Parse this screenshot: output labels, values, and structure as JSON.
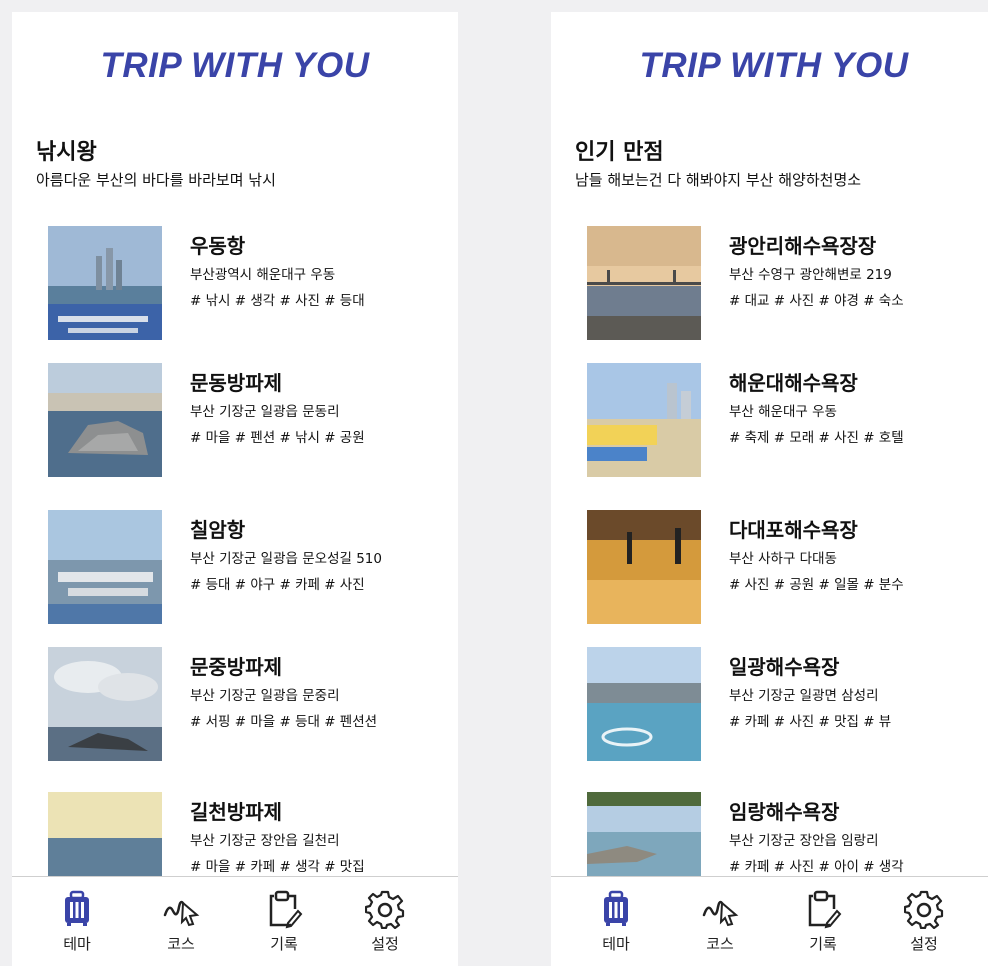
{
  "screens": [
    {
      "brand": "TRIP WITH YOU",
      "theme": {
        "title": "낚시왕",
        "subtitle": "아름다운 부산의 바다를 바라보며 낚시"
      },
      "items": [
        {
          "name": "우동항",
          "address": "부산광역시 해운대구 우동",
          "tags": "# 낚시 # 생각 # 사진 # 등대"
        },
        {
          "name": "문동방파제",
          "address": "부산 기장군 일광읍 문동리",
          "tags": "# 마을 # 펜션 # 낚시 # 공원"
        },
        {
          "name": "칠암항",
          "address": "부산 기장군 일광읍 문오성길 510",
          "tags": "# 등대 # 야구 # 카페 # 사진"
        },
        {
          "name": "문중방파제",
          "address": "부산 기장군 일광읍 문중리",
          "tags": "# 서핑 # 마을 # 등대 # 펜션션"
        },
        {
          "name": "길천방파제",
          "address": "부산 기장군 장안읍 길천리",
          "tags": "# 마을 # 카페 # 생각 # 맛집"
        }
      ],
      "nav": [
        {
          "label": "테마",
          "icon": "suitcase-icon",
          "active": true
        },
        {
          "label": "코스",
          "icon": "route-cursor-icon"
        },
        {
          "label": "기록",
          "icon": "clipboard-pen-icon"
        },
        {
          "label": "설정",
          "icon": "gear-icon"
        }
      ]
    },
    {
      "brand": "TRIP WITH YOU",
      "theme": {
        "title": "인기 만점",
        "subtitle": "남들 해보는건 다 해봐야지 부산 해양하천명소"
      },
      "items": [
        {
          "name": "광안리해수욕장장",
          "address": "부산 수영구 광안해변로 219",
          "tags": "# 대교 # 사진 # 야경 # 숙소"
        },
        {
          "name": "해운대해수욕장",
          "address": "부산 해운대구 우동",
          "tags": "# 축제 # 모래 # 사진 # 호텔"
        },
        {
          "name": "다대포해수욕장",
          "address": "부산 사하구 다대동",
          "tags": "# 사진 # 공원 # 일몰 # 분수"
        },
        {
          "name": "일광해수욕장",
          "address": "부산 기장군 일광면 삼성리",
          "tags": "# 카페 # 사진 # 맛집 # 뷰"
        },
        {
          "name": "임랑해수욕장",
          "address": "부산 기장군 장안읍 임랑리",
          "tags": "# 카페 # 사진 # 아이 # 생각"
        }
      ],
      "nav": [
        {
          "label": "테마",
          "icon": "suitcase-icon",
          "active": true
        },
        {
          "label": "코스",
          "icon": "route-cursor-icon"
        },
        {
          "label": "기록",
          "icon": "clipboard-pen-icon"
        },
        {
          "label": "설정",
          "icon": "gear-icon"
        }
      ]
    }
  ],
  "colors": {
    "brand": "#3a44a8",
    "active_icon": "#3a44a8",
    "icon": "#222222"
  }
}
